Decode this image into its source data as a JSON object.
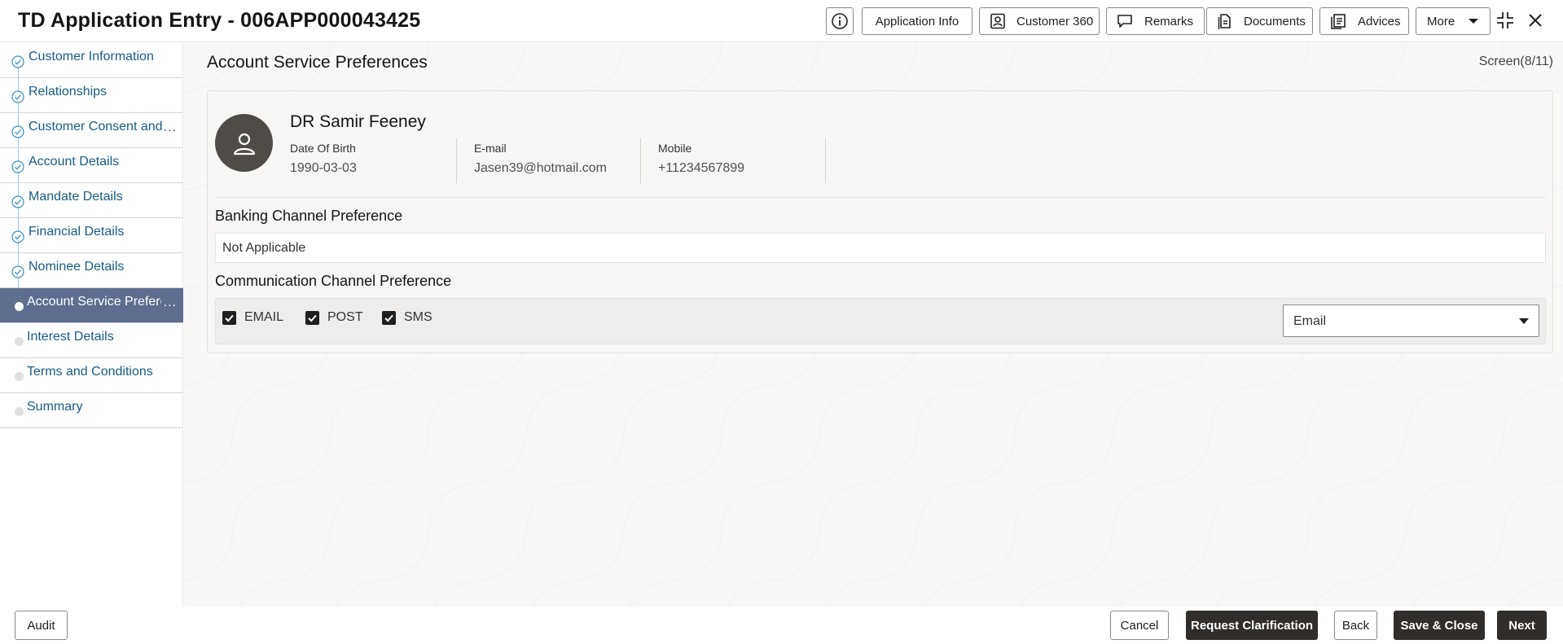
{
  "header": {
    "title": "TD Application Entry - 006APP000043425",
    "buttons": {
      "application_info": "Application Info",
      "customer_360": "Customer 360",
      "remarks": "Remarks",
      "documents": "Documents",
      "advices": "Advices",
      "more": "More"
    },
    "icons": [
      "info-icon",
      "customer-360-icon",
      "remarks-icon",
      "documents-icon",
      "advices-icon",
      "chevron-down-icon",
      "minimize-icon",
      "close-icon"
    ]
  },
  "sidebar": {
    "items": [
      {
        "label": "Customer Information",
        "state": "completed"
      },
      {
        "label": "Relationships",
        "state": "completed"
      },
      {
        "label": "Customer Consent and",
        "state": "completed",
        "overflow": "..."
      },
      {
        "label": "Account Details",
        "state": "completed"
      },
      {
        "label": "Mandate Details",
        "state": "completed"
      },
      {
        "label": "Financial Details",
        "state": "completed"
      },
      {
        "label": "Nominee Details",
        "state": "completed"
      },
      {
        "label": "Account Service Prefere",
        "state": "active",
        "overflow": "..."
      },
      {
        "label": "Interest Details",
        "state": "pending"
      },
      {
        "label": "Terms and Conditions",
        "state": "pending"
      },
      {
        "label": "Summary",
        "state": "pending"
      }
    ]
  },
  "main": {
    "page_title": "Account Service Preferences",
    "screen_counter": "Screen(8/11)",
    "customer": {
      "name": "DR Samir Feeney",
      "dob_label": "Date Of Birth",
      "dob": "1990-03-03",
      "email_label": "E-mail",
      "email": "Jasen39@hotmail.com",
      "mobile_label": "Mobile",
      "mobile": "+11234567899"
    },
    "banking_channel": {
      "label": "Banking Channel Preference",
      "value": "Not Applicable"
    },
    "communication_channel": {
      "label": "Communication Channel Preference",
      "options": [
        {
          "label": "EMAIL",
          "checked": true
        },
        {
          "label": "POST",
          "checked": true
        },
        {
          "label": "SMS",
          "checked": true
        }
      ],
      "preferred": "Email"
    }
  },
  "footer": {
    "audit": "Audit",
    "cancel": "Cancel",
    "request_clarification": "Request Clarification",
    "back": "Back",
    "save_close": "Save & Close",
    "next": "Next"
  },
  "colors": {
    "active_nav_bg": "#5f6e8e",
    "link_blue": "#1b5a84",
    "primary_button": "#312d2a",
    "avatar_bg": "#4f4c47"
  }
}
